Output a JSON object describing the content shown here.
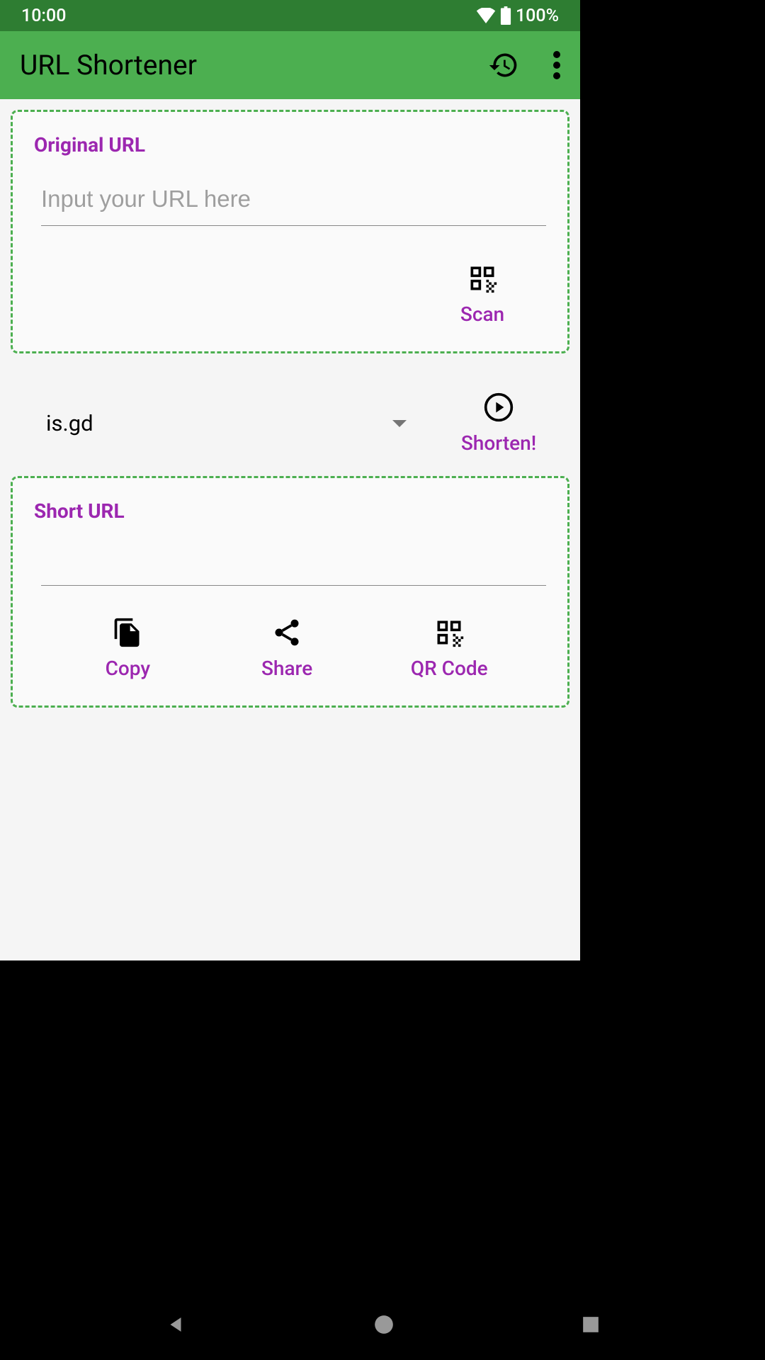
{
  "status": {
    "time": "10:00",
    "battery": "100%"
  },
  "appbar": {
    "title": "URL Shortener"
  },
  "original": {
    "label": "Original URL",
    "placeholder": "Input your URL here",
    "scan": "Scan"
  },
  "middle": {
    "provider": "is.gd",
    "shorten": "Shorten!"
  },
  "short": {
    "label": "Short URL",
    "value": "",
    "copy": "Copy",
    "share": "Share",
    "qrcode": "QR Code"
  }
}
